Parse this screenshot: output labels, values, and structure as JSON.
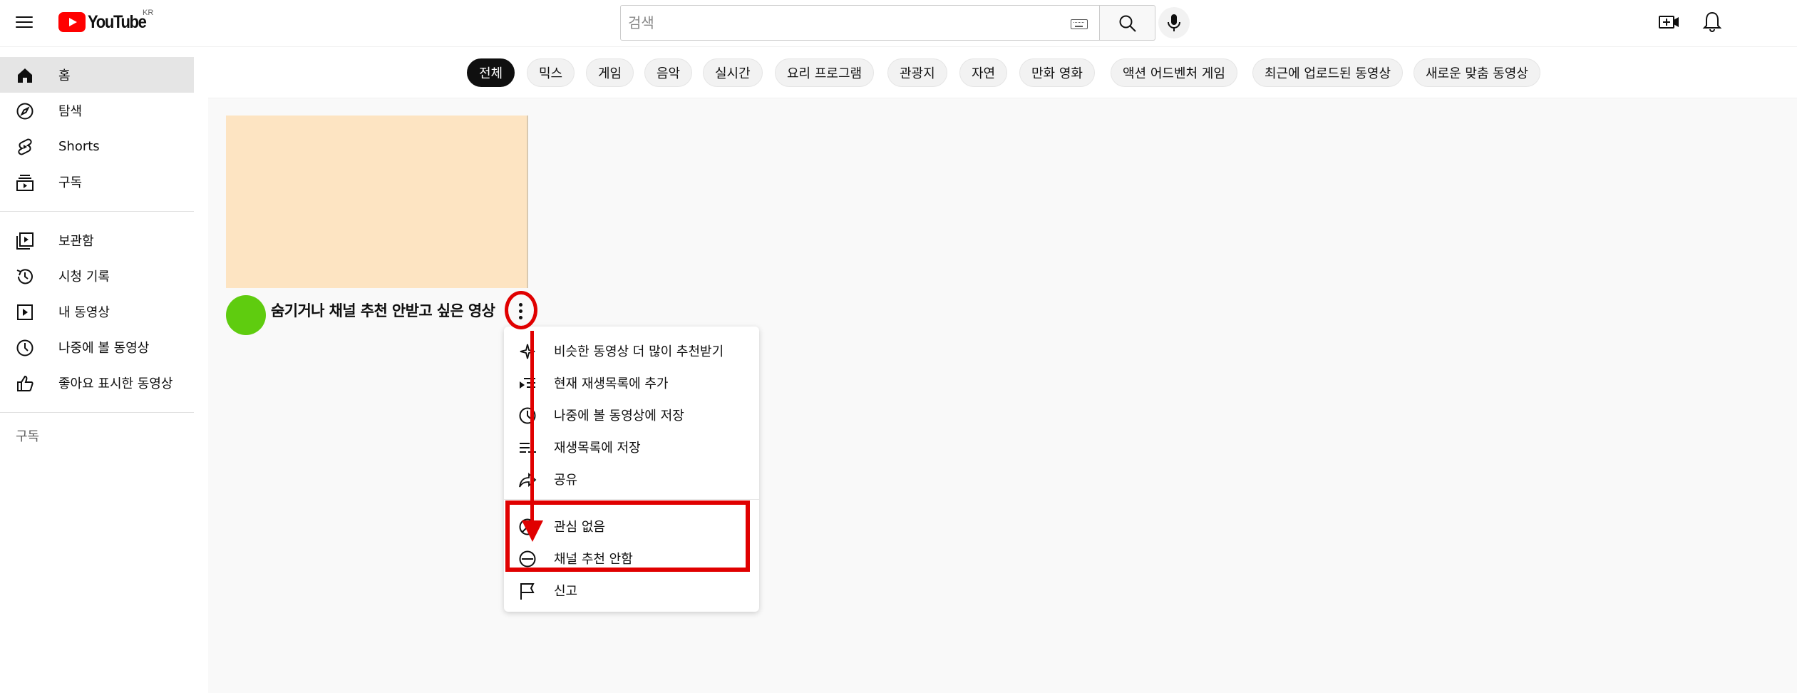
{
  "header": {
    "logo_text": "YouTube",
    "logo_region": "KR",
    "search_placeholder": "검색"
  },
  "sidebar": {
    "items_primary": [
      {
        "label": "홈",
        "icon": "home-icon",
        "active": true
      },
      {
        "label": "탐색",
        "icon": "compass-icon"
      },
      {
        "label": "Shorts",
        "icon": "shorts-icon"
      },
      {
        "label": "구독",
        "icon": "subscriptions-icon"
      }
    ],
    "items_library": [
      {
        "label": "보관함",
        "icon": "library-icon"
      },
      {
        "label": "시청 기록",
        "icon": "history-icon"
      },
      {
        "label": "내 동영상",
        "icon": "your-videos-icon"
      },
      {
        "label": "나중에 볼 동영상",
        "icon": "watch-later-icon"
      },
      {
        "label": "좋아요 표시한 동영상",
        "icon": "liked-icon"
      }
    ],
    "section_subscriptions": "구독"
  },
  "chips": [
    "전체",
    "믹스",
    "게임",
    "음악",
    "실시간",
    "요리 프로그램",
    "관광지",
    "자연",
    "만화 영화",
    "액션 어드벤처 게임",
    "최근에 업로드된 동영상",
    "새로운 맞춤 동영상"
  ],
  "video": {
    "title": "숨기거나 채널 추천 안받고 싶은 영상"
  },
  "menu": {
    "items": [
      {
        "label": "비슷한 동영상 더 많이 추천받기",
        "icon": "sparkle-icon"
      },
      {
        "label": "현재 재생목록에 추가",
        "icon": "queue-icon"
      },
      {
        "label": "나중에 볼 동영상에 저장",
        "icon": "clock-icon"
      },
      {
        "label": "재생목록에 저장",
        "icon": "playlist-add-icon"
      },
      {
        "label": "공유",
        "icon": "share-icon"
      },
      {
        "label": "관심 없음",
        "icon": "not-interested-icon"
      },
      {
        "label": "채널 추천 안함",
        "icon": "dont-recommend-icon"
      },
      {
        "label": "신고",
        "icon": "flag-icon"
      }
    ]
  },
  "colors": {
    "annotation": "#e00000",
    "thumbnail": "#fde4c2",
    "avatar": "#5fcc0f",
    "youtube_red": "#ff0000"
  }
}
